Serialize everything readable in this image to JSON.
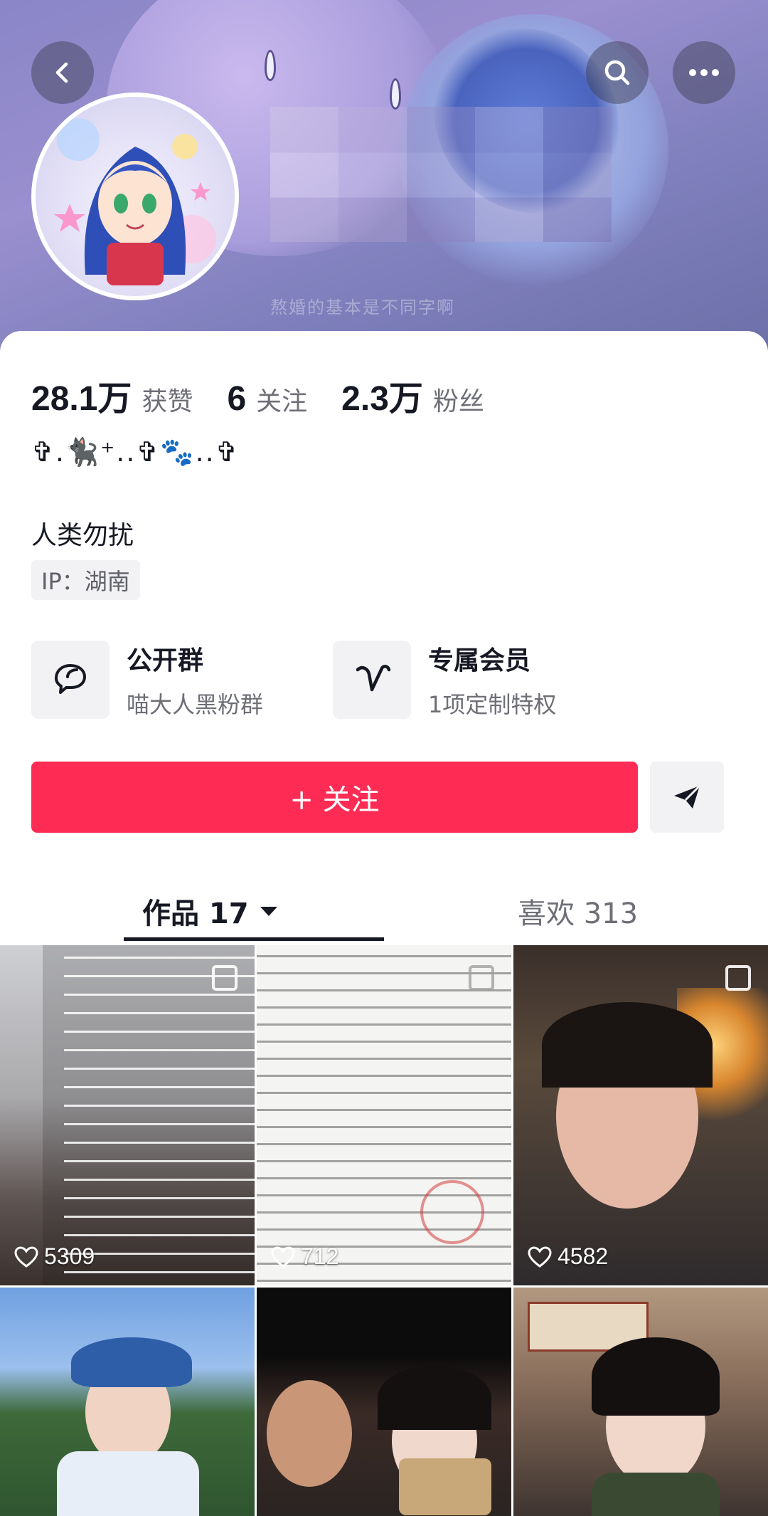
{
  "banner": {
    "watermark_text": "熬婚的基本是不同字啊"
  },
  "stats": [
    {
      "value": "28.1万",
      "label": "获赞"
    },
    {
      "value": "6",
      "label": "关注"
    },
    {
      "value": "2.3万",
      "label": "粉丝"
    }
  ],
  "profile": {
    "name_emoji": "✞.🐈‍⬛⁺..✞🐾..✞",
    "bio": "人类勿扰",
    "ip": "IP：湖南"
  },
  "features": [
    {
      "title": "公开群",
      "subtitle": "喵大人黑粉群",
      "icon": "chat-bubbles-icon"
    },
    {
      "title": "专属会员",
      "subtitle": "1项定制特权",
      "icon": "heart-v-icon"
    }
  ],
  "actions": {
    "follow_label": "+ 关注",
    "share_icon": "send-icon"
  },
  "tabs": {
    "works_label": "作品 17",
    "likes_label": "喜欢 313"
  },
  "videos": [
    {
      "likes": "5309"
    },
    {
      "likes": "712"
    },
    {
      "likes": "4582"
    },
    {
      "likes": ""
    },
    {
      "likes": ""
    },
    {
      "likes": ""
    }
  ],
  "colors": {
    "accent": "#fe2c55",
    "text_primary": "#161823",
    "text_secondary": "#6e6f76",
    "surface": "#f2f2f4"
  }
}
